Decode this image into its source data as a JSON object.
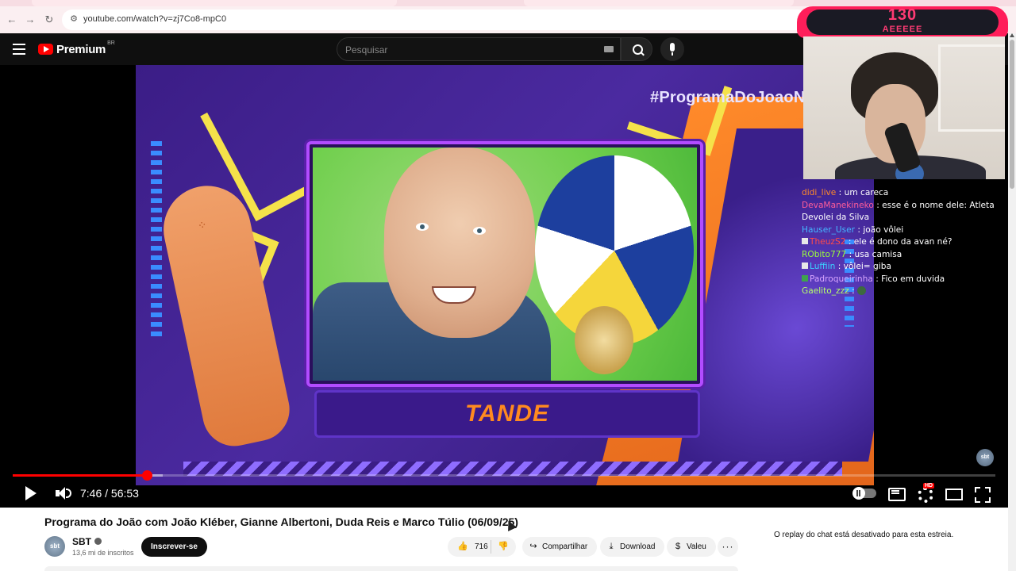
{
  "browser": {
    "url": "youtube.com/watch?v=zj7Co8-mpC0"
  },
  "masthead": {
    "brand": "Premium",
    "region": "BR",
    "search_placeholder": "Pesquisar"
  },
  "player": {
    "hashtag": "#ProgramaDoJoaoN",
    "name_plate": "TANDE",
    "watermark": "sbt",
    "current_time": "7:46",
    "duration": "56:53",
    "time_display": "7:46 / 56:53",
    "progress_fraction": 0.1365,
    "buffer_fraction": 0.1525,
    "hd_badge": "HD",
    "accent_color": "#ff0000"
  },
  "stream_overlay": {
    "counter": "130",
    "subtitle": "AEEEEE",
    "chat": [
      {
        "user": "didi_live",
        "color": "#ff8a2a",
        "text": " : um careca"
      },
      {
        "user": "DevaManekineko",
        "color": "#ff5c9a",
        "text": " : esse é o nome dele: Atleta Devolei da Silva"
      },
      {
        "user": "Hauser_User",
        "color": "#45b5ff",
        "text": " : joão vôlei"
      },
      {
        "user": "TheuzS2",
        "color": "#ff4a4a",
        "text": " : ele é dono da avan né?",
        "badge": "white"
      },
      {
        "user": "RObito777",
        "color": "#9bff3a",
        "text": " : usa camisa"
      },
      {
        "user": "Luffiin",
        "color": "#3ad3ff",
        "text": " : vôlei= giba",
        "badge": "white"
      },
      {
        "user": "Padroqueirinha",
        "color": "#d8a6ff",
        "text": " : Fico em duvida",
        "badge": "green"
      },
      {
        "user": "Gaelito_zzz",
        "color": "#b6ff6a",
        "text": " : ",
        "emote": true
      }
    ]
  },
  "video": {
    "title": "Programa do João com João Kléber, Gianne Albertoni, Duda Reis e Marco Túlio (06/09/25)",
    "channel": "SBT",
    "channel_avatar_text": "sbt",
    "subscribers": "13,6 mi de inscritos",
    "subscribe_label": "Inscrever-se",
    "likes": "716",
    "share_label": "Compartilhar",
    "download_label": "Download",
    "valeu_label": "Valeu",
    "more_label": "···"
  },
  "chat_status": "O replay do chat está desativado para esta estreia.",
  "icons": {
    "like": "thumbs-up-icon",
    "dislike": "thumbs-down-icon",
    "share": "share-icon",
    "download": "download-icon",
    "valeu": "thanks-icon"
  }
}
